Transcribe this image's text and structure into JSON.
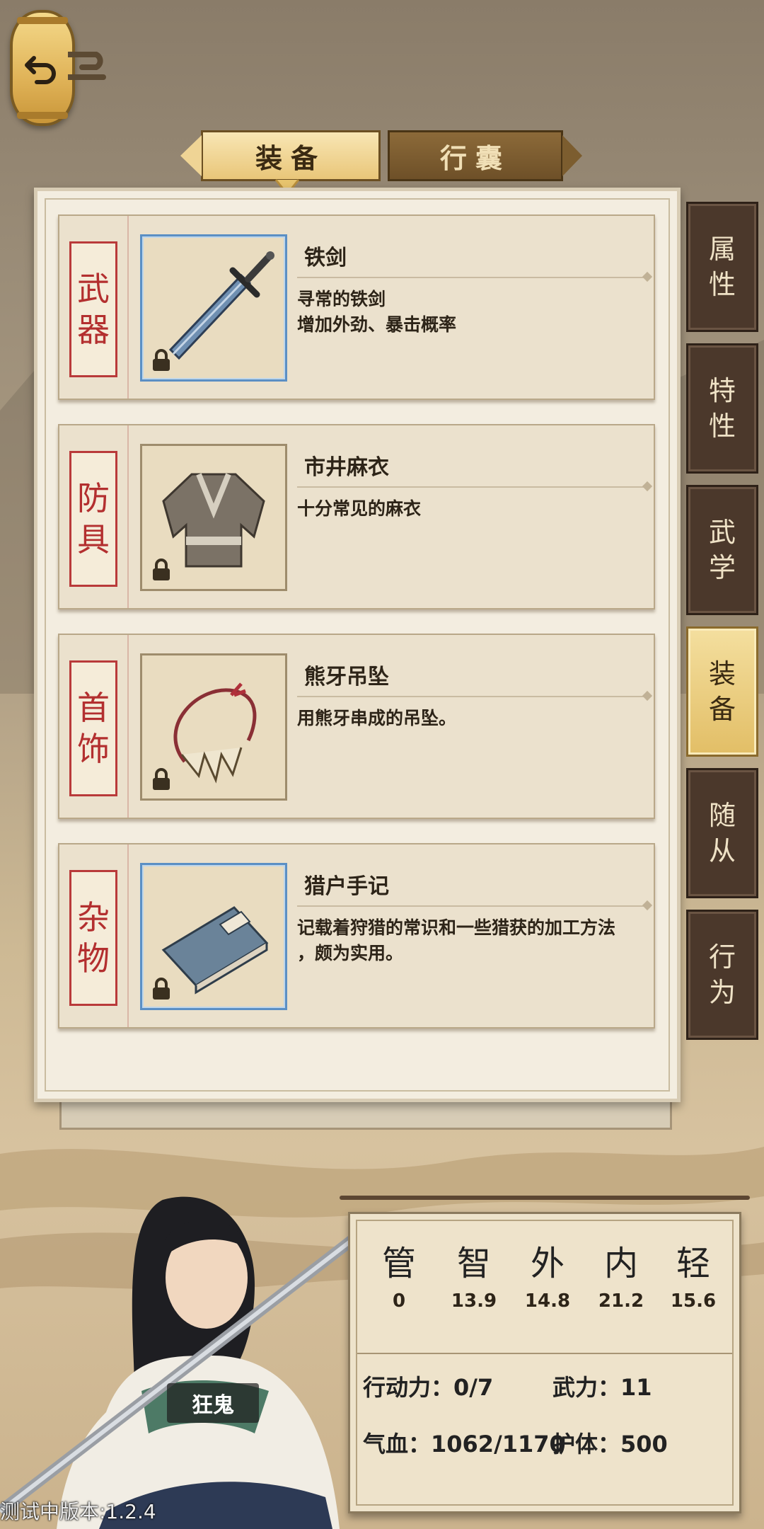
{
  "top_tabs": {
    "equip": "装备",
    "bag": "行囊"
  },
  "slots": [
    {
      "category": [
        "武",
        "器"
      ],
      "name": "铁剑",
      "desc": [
        "寻常的铁剑",
        "增加外劲、暴击概率"
      ]
    },
    {
      "category": [
        "防",
        "具"
      ],
      "name": "市井麻衣",
      "desc": [
        "十分常见的麻衣"
      ]
    },
    {
      "category": [
        "首",
        "饰"
      ],
      "name": "熊牙吊坠",
      "desc": [
        "用熊牙串成的吊坠。"
      ]
    },
    {
      "category": [
        "杂",
        "物"
      ],
      "name": "猎户手记",
      "desc": [
        "记载着狩猎的常识和一些猎获的加工方法",
        "，颇为实用。"
      ]
    }
  ],
  "side_tabs": [
    [
      "属",
      "性"
    ],
    [
      "特",
      "性"
    ],
    [
      "武",
      "学"
    ],
    [
      "装",
      "备"
    ],
    [
      "随",
      "从"
    ],
    [
      "行",
      "为"
    ]
  ],
  "stats": {
    "attrs": [
      {
        "name": "管",
        "value": "0"
      },
      {
        "name": "智",
        "value": "13.9"
      },
      {
        "name": "外",
        "value": "14.8"
      },
      {
        "name": "内",
        "value": "21.2"
      },
      {
        "name": "轻",
        "value": "15.6"
      }
    ],
    "action_label": "行动力：0/7",
    "force_label": "武力：11",
    "hp_label": "气血：1062/1170",
    "armor_label": "护体：500"
  },
  "character": {
    "name": "狂鬼"
  },
  "version": "测试中版本:1.2.4",
  "colors": {
    "active_tab": "#e9c679",
    "category_red": "#b32f2f",
    "side_tab": "#4b382b"
  },
  "icons": {
    "back": "back-arrow-icon",
    "lock": "lock-icon"
  }
}
